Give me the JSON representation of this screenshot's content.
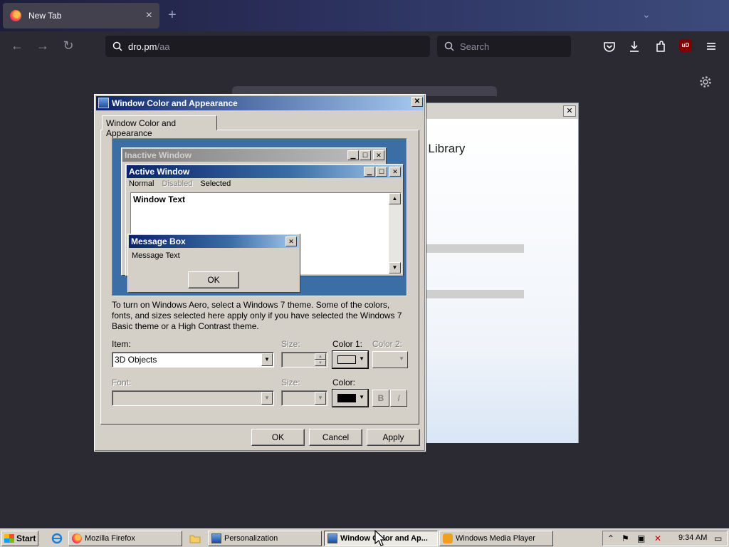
{
  "browser": {
    "tab_title": "New Tab",
    "tab_close": "×",
    "new_tab": "+",
    "list_all_tabs": "⌄",
    "back": "←",
    "forward": "→",
    "reload": "↻",
    "url_host": "dro.pm",
    "url_path": "/aa",
    "search_placeholder": "Search",
    "ublock_label": "uD"
  },
  "background_window": {
    "close": "✕",
    "title_fragment": "r Library"
  },
  "dialog": {
    "title": "Window Color and Appearance",
    "close": "✕",
    "tab": "Window Color and Appearance",
    "preview": {
      "inactive_title": "Inactive Window",
      "active_title": "Active Window",
      "menu_normal": "Normal",
      "menu_disabled": "Disabled",
      "menu_selected": "Selected",
      "window_text": "Window Text",
      "msgbox_title": "Message Box",
      "msgbox_text": "Message Text",
      "msgbox_ok": "OK"
    },
    "info": "To turn on Windows Aero, select a Windows 7 theme.  Some of the colors, fonts, and sizes selected here apply only if you have selected the Windows 7 Basic theme or a High Contrast theme.",
    "item_label": "Item:",
    "item_value": "3D Objects",
    "size_label": "Size:",
    "color1_label": "Color 1:",
    "color2_label": "Color 2:",
    "font_label": "Font:",
    "font_size_label": "Size:",
    "color_label": "Color:",
    "bold": "B",
    "italic": "I",
    "ok": "OK",
    "cancel": "Cancel",
    "apply": "Apply",
    "color1_value": "#d4d0c8",
    "font_color_value": "#000000"
  },
  "taskbar": {
    "start": "Start",
    "items": [
      {
        "label": "Mozilla Firefox"
      },
      {
        "label": "Personalization"
      },
      {
        "label": "Window Color and Ap..."
      },
      {
        "label": "Windows Media Player"
      }
    ],
    "clock": "9:34 AM"
  }
}
